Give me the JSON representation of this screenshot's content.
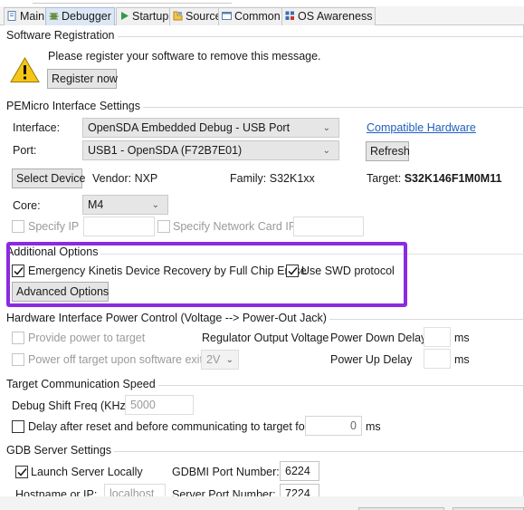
{
  "tabs": [
    {
      "label": "Main",
      "icon": "main-tab-icon"
    },
    {
      "label": "Debugger",
      "icon": "debugger-tab-icon",
      "active": true
    },
    {
      "label": "Startup",
      "icon": "startup-tab-icon"
    },
    {
      "label": "Source",
      "icon": "source-tab-icon"
    },
    {
      "label": "Common",
      "icon": "common-tab-icon"
    },
    {
      "label": "OS Awareness",
      "icon": "os-awareness-tab-icon"
    }
  ],
  "registration": {
    "title": "Software Registration",
    "message": "Please register your software to remove this message.",
    "button": "Register now",
    "icon": "warning-icon"
  },
  "pemicro": {
    "title": "PEMicro Interface Settings",
    "interface_label": "Interface:",
    "interface_value": "OpenSDA Embedded Debug - USB Port",
    "compatible_link": "Compatible Hardware",
    "port_label": "Port:",
    "port_value": "USB1 - OpenSDA (F72B7E01)",
    "refresh": "Refresh",
    "select_device": "Select Device",
    "vendor": "Vendor: NXP",
    "family": "Family: S32K1xx",
    "target_label": "Target:",
    "target_value": "S32K146F1M0M11",
    "core_label": "Core:",
    "core_value": "M4",
    "specify_ip": "Specify IP",
    "specify_nic": "Specify Network Card IP"
  },
  "additional": {
    "title": "Additional Options",
    "emergency": "Emergency Kinetis Device Recovery by Full Chip Erase",
    "use_swd": "Use SWD protocol",
    "advanced": "Advanced Options",
    "highlight_color": "#8a2be2"
  },
  "power": {
    "title": "Hardware Interface Power Control (Voltage --> Power-Out Jack)",
    "provide_power": "Provide power to target",
    "regulator_label": "Regulator Output Voltage",
    "power_down_label": "Power Down Delay",
    "power_down_unit": "ms",
    "power_off": "Power off target upon software exit",
    "voltage_value": "2V",
    "power_up_label": "Power Up Delay",
    "power_up_unit": "ms"
  },
  "speed": {
    "title": "Target Communication Speed",
    "shift_label": "Debug Shift Freq (KHz)",
    "shift_value": "5000",
    "delay_label": "Delay after reset and before communicating to target for",
    "delay_value": "0",
    "delay_unit": "ms"
  },
  "gdb": {
    "title": "GDB Server Settings",
    "launch_local": "Launch Server Locally",
    "gdbmi_label": "GDBMI Port Number:",
    "gdbmi_value": "6224",
    "hostname_label": "Hostname or IP:",
    "hostname_value": "localhost",
    "server_port_label": "Server Port Number:",
    "server_port_value": "7224"
  }
}
